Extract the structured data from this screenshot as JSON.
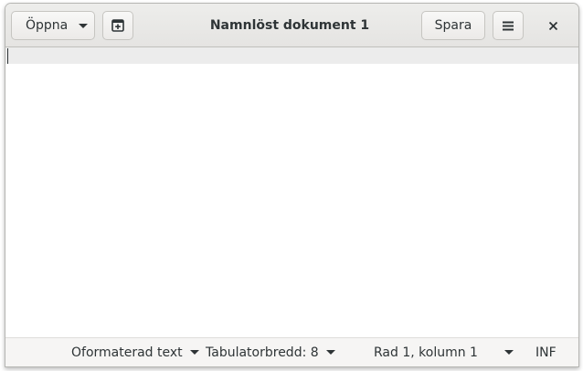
{
  "window": {
    "title": "Namnlöst dokument 1"
  },
  "headerbar": {
    "open_label": "Öppna",
    "save_label": "Spara",
    "open_icon": "chevron-down-icon",
    "new_icon": "new-tab-icon",
    "menu_icon": "hamburger-menu-icon",
    "close_icon": "close-icon"
  },
  "editor": {
    "content": ""
  },
  "statusbar": {
    "language": "Oformaterad text",
    "tab_width": "Tabulatorbredd: 8",
    "position": "Rad 1, kolumn 1",
    "insert_mode": "INF"
  },
  "colors": {
    "headerbar": "#e8e7e5",
    "current_line": "#ececec",
    "statusbar": "#f6f5f4",
    "text": "#2e3436"
  }
}
